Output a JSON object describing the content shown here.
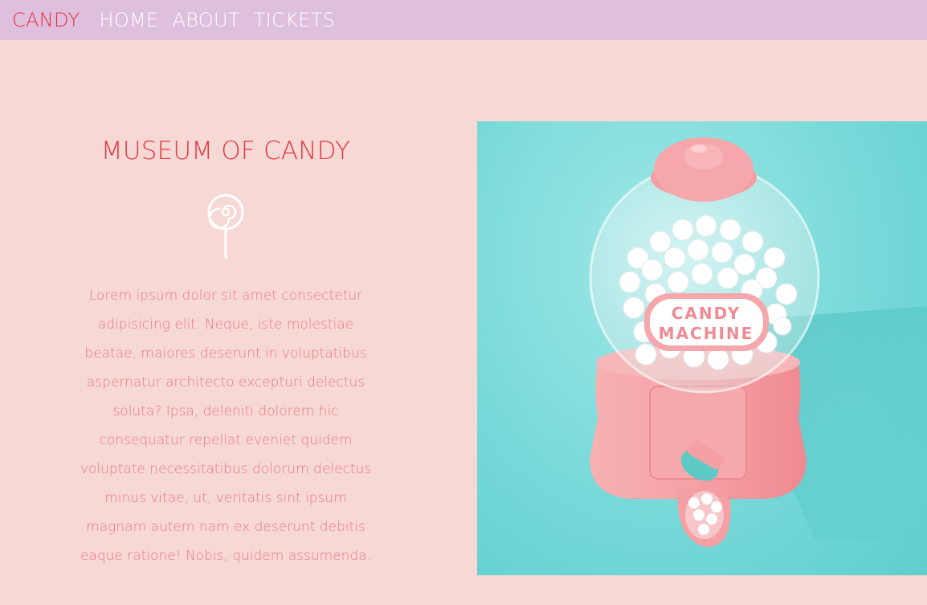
{
  "nav": {
    "brand": "CANDY",
    "links": [
      "HOME",
      "ABOUT",
      "TICKETS"
    ]
  },
  "hero": {
    "title": "MUSEUM OF CANDY",
    "description": "Lorem ipsum dolor sit amet consectetur adipisicing elit. Neque, iste molestiae beatae, maiores deserunt in voluptatibus aspernatur architecto excepturi delectus soluta? Ipsa, deleniti dolorem hic consequatur repellat eveniet quidem voluptate necessitatibus dolorum delectus minus vitae, ut, veritatis sint ipsum magnam autem nam ex deserunt debitis eaque ratione! Nobis, quidem assumenda.",
    "image": {
      "label": "CANDY MACHINE",
      "label_line1": "CANDY",
      "label_line2": "MACHINE"
    }
  },
  "colors": {
    "nav_bg": "#dfbfde",
    "page_bg": "#f6d8d4",
    "brand": "#ec3040",
    "title": "#e63645",
    "body_text": "#f07686",
    "image_bg": "#78d9d9",
    "machine_pink": "#f4a3a6"
  },
  "icons": {
    "lollipop": "lollipop-icon"
  }
}
